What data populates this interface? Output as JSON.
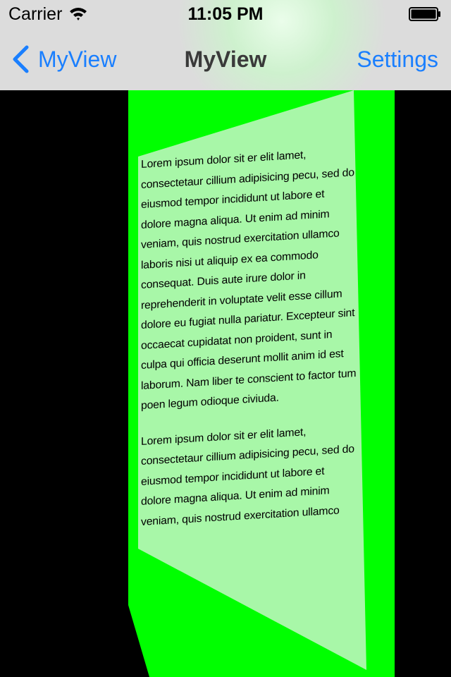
{
  "status_bar": {
    "carrier": "Carrier",
    "time": "11:05 PM",
    "wifi_icon": "wifi-icon",
    "battery_icon": "battery-full-icon"
  },
  "nav_bar": {
    "back_label": "MyView",
    "title": "MyView",
    "right_button_label": "Settings",
    "back_icon": "chevron-left-icon"
  },
  "content": {
    "paragraphs": [
      "Lorem ipsum dolor sit er elit lamet, consectetaur cillium adipisicing pecu, sed do eiusmod tempor incididunt ut labore et dolore magna aliqua. Ut enim ad minim veniam, quis nostrud exercitation ullamco laboris nisi ut aliquip ex ea commodo consequat. Duis aute irure dolor in reprehenderit in voluptate velit esse cillum dolore eu fugiat nulla pariatur. Excepteur sint occaecat cupidatat non proident, sunt in culpa qui officia deserunt mollit anim id est laborum. Nam liber te conscient to factor tum poen legum odioque civiuda.",
      "Lorem ipsum dolor sit er elit lamet, consectetaur cillium adipisicing pecu, sed do eiusmod tempor incididunt ut labore et dolore magna aliqua. Ut enim ad minim veniam, quis nostrud exercitation ullamco"
    ]
  },
  "colors": {
    "tint": "#1a7fff",
    "panel_green": "#00ff00",
    "page_green": "#a8f7a8",
    "background": "#000000",
    "nav_background": "#dcdcdc"
  }
}
